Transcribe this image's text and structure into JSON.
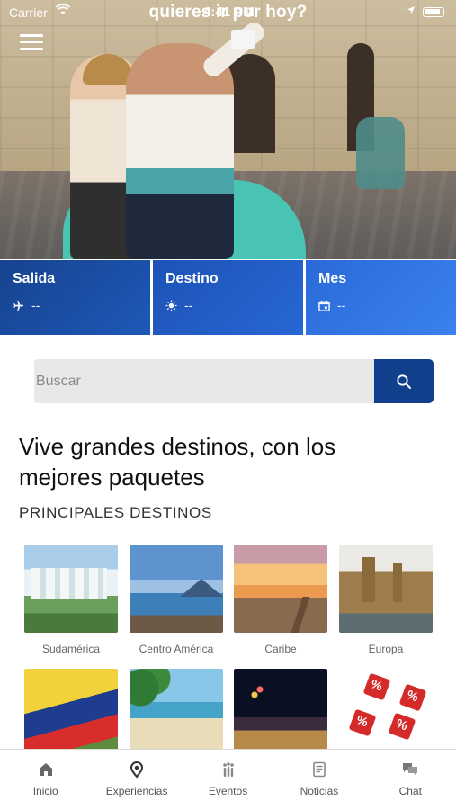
{
  "status_bar": {
    "carrier": "Carrier",
    "time": "4:41 PM"
  },
  "hero": {
    "overlay_title": "quieres ir por hoy?"
  },
  "filters": [
    {
      "label": "Salida",
      "value": "--",
      "icon": "airplane-icon"
    },
    {
      "label": "Destino",
      "value": "--",
      "icon": "sun-icon"
    },
    {
      "label": "Mes",
      "value": "--",
      "icon": "calendar-icon"
    }
  ],
  "search": {
    "placeholder": "Buscar",
    "icon": "search-icon"
  },
  "headline": "Vive grandes destinos, con los mejores paquetes",
  "section_title": "PRINCIPALES DESTINOS",
  "destinations": [
    {
      "label": "Sudamérica"
    },
    {
      "label": "Centro América"
    },
    {
      "label": "Caribe"
    },
    {
      "label": "Europa"
    },
    {
      "label": ""
    },
    {
      "label": ""
    },
    {
      "label": ""
    },
    {
      "label": ""
    }
  ],
  "tabbar": [
    {
      "label": "Inicio",
      "icon": "home-icon"
    },
    {
      "label": "Experiencias",
      "icon": "map-pin-icon"
    },
    {
      "label": "Eventos",
      "icon": "events-icon"
    },
    {
      "label": "Noticias",
      "icon": "news-icon"
    },
    {
      "label": "Chat",
      "icon": "chat-icon"
    }
  ],
  "colors": {
    "primary_dark": "#123f8c",
    "primary_mid": "#1e58b8",
    "primary_light": "#3a82ee"
  }
}
